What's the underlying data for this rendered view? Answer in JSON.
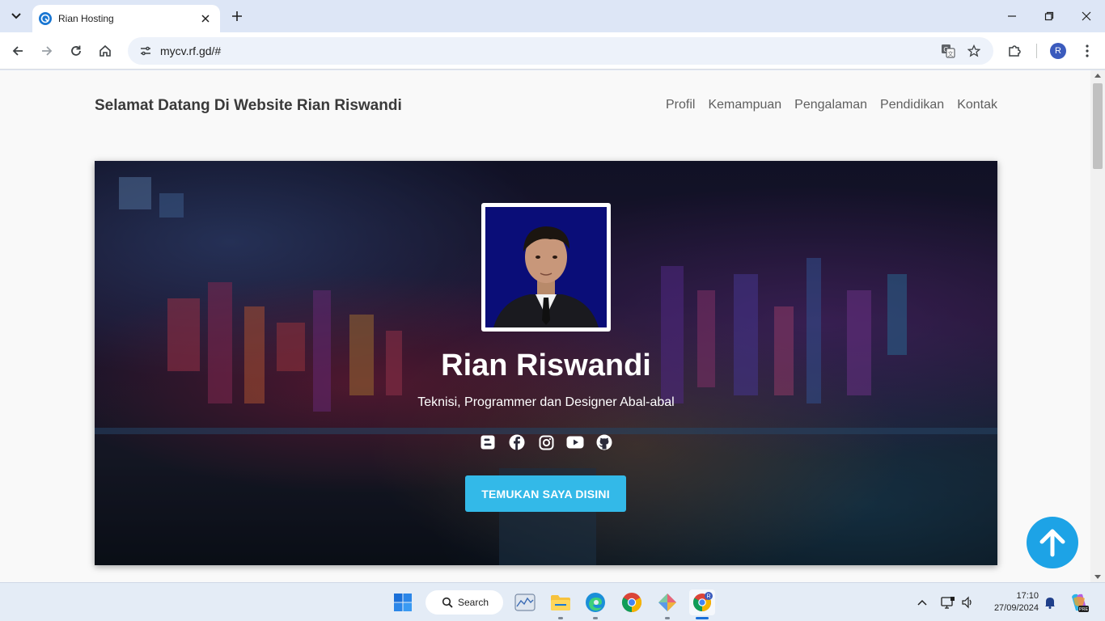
{
  "browser": {
    "tab_title": "Rian Hosting",
    "url": "mycv.rf.gd/#",
    "profile_initial": "R"
  },
  "site": {
    "brand": "Selamat Datang Di Website Rian Riswandi",
    "nav": [
      "Profil",
      "Kemampuan",
      "Pengalaman",
      "Pendidikan",
      "Kontak"
    ]
  },
  "hero": {
    "name": "Rian Riswandi",
    "tagline": "Teknisi, Programmer dan Designer Abal-abal",
    "social_icons": [
      "blogger-icon",
      "facebook-icon",
      "instagram-icon",
      "youtube-icon",
      "github-icon"
    ],
    "cta_label": "TEMUKAN SAYA DISINI"
  },
  "taskbar": {
    "search_label": "Search",
    "time": "17:10",
    "date": "27/09/2024"
  },
  "colors": {
    "cta": "#33b9e8",
    "back_to_top": "#1da3e6",
    "photo_bg": "#0a0d78"
  }
}
